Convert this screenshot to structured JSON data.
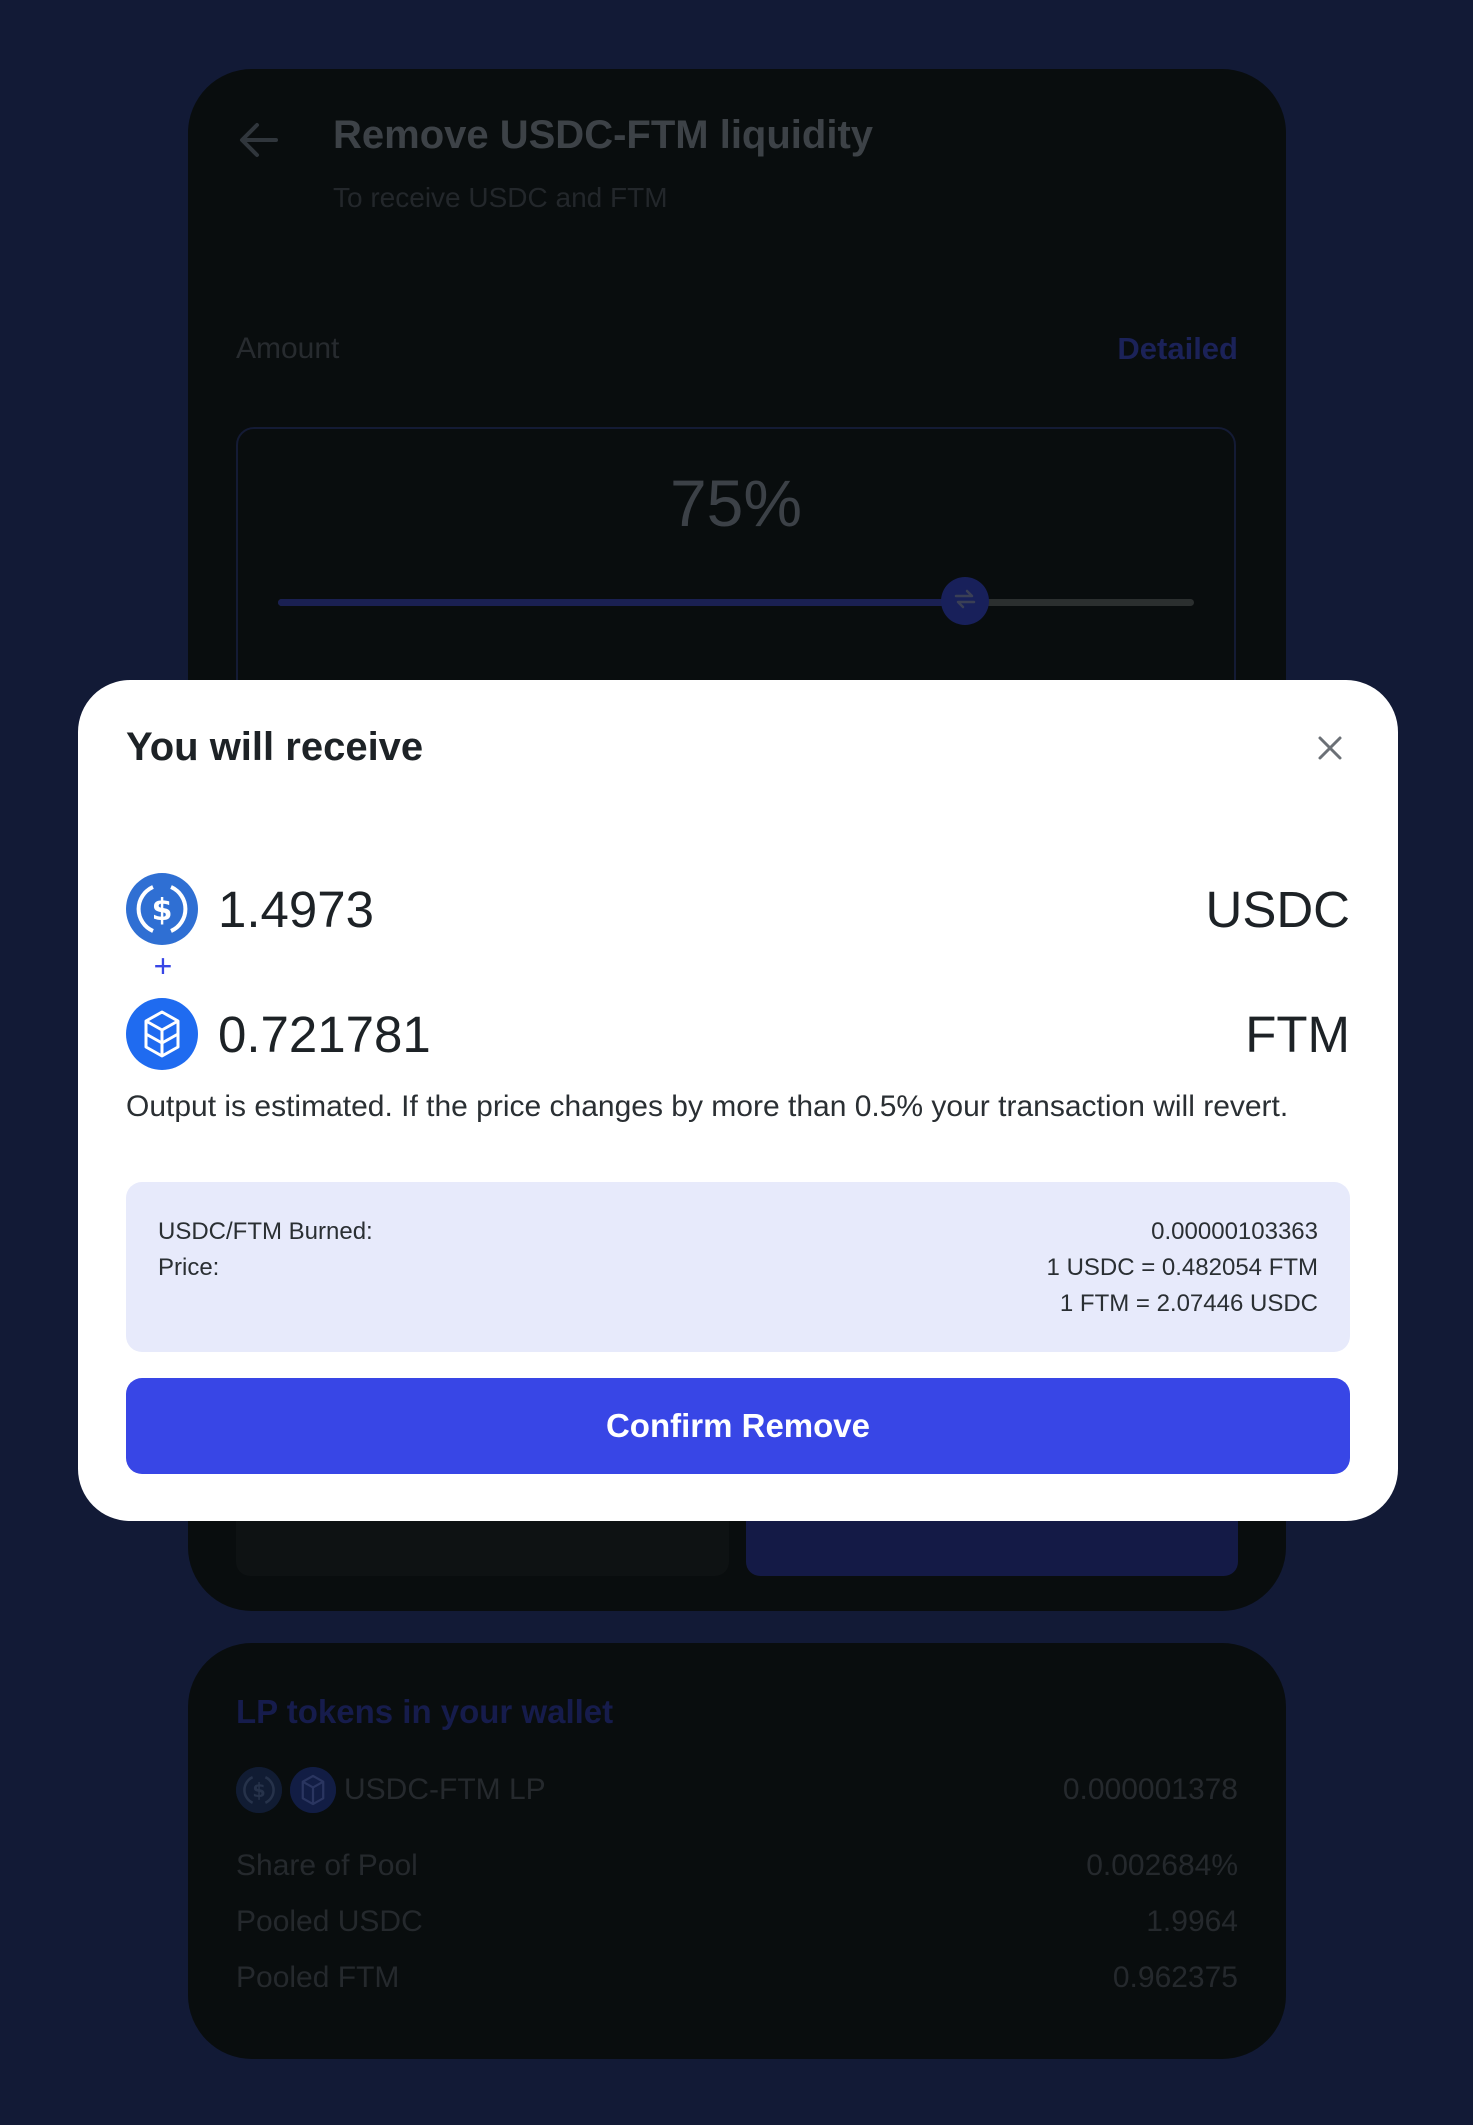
{
  "colors": {
    "page_background": "#121a36",
    "card_background": "#090d0e",
    "modal_background": "#ffffff",
    "accent": "#3846e6",
    "info_box": "#e7eafb",
    "usdc_icon": "#2f6fd3",
    "ftm_icon": "#1f6bf0"
  },
  "remove_card": {
    "back_icon": "arrow-left-icon",
    "title": "Remove USDC-FTM liquidity",
    "subtitle": "To receive USDC and FTM",
    "amount_label": "Amount",
    "detailed_link": "Detailed",
    "percent_label": "75%",
    "slider_percent": 75
  },
  "lp_card": {
    "title": "LP tokens in your wallet",
    "token_name": "USDC-FTM LP",
    "token_balance": "0.000001378",
    "rows": [
      {
        "label": "Share of Pool",
        "value": "0.002684%"
      },
      {
        "label": "Pooled USDC",
        "value": "1.9964"
      },
      {
        "label": "Pooled FTM",
        "value": "0.962375"
      }
    ]
  },
  "modal": {
    "title": "You will receive",
    "close_icon": "close-icon",
    "tokens": [
      {
        "amount": "1.4973",
        "symbol": "USDC",
        "icon": "usdc-icon"
      },
      {
        "amount": "0.721781",
        "symbol": "FTM",
        "icon": "ftm-icon"
      }
    ],
    "plus": "+",
    "notice": "Output is estimated. If the price changes by more than 0.5% your transaction will revert.",
    "info": {
      "burned_label": "USDC/FTM Burned:",
      "burned_value": "0.00000103363",
      "price_label": "Price:",
      "price_value_1": "1 USDC = 0.482054 FTM",
      "price_value_2": "1 FTM = 2.07446 USDC"
    },
    "confirm_button": "Confirm Remove"
  }
}
